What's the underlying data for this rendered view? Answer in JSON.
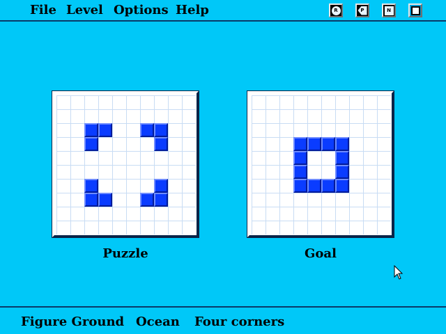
{
  "menu": [
    "File",
    "Level",
    "Options",
    "Help"
  ],
  "toolbar": {
    "reset_glyph": "R",
    "prev_glyph": "P",
    "next_glyph": "N",
    "exit_glyph": ""
  },
  "boards": {
    "puzzle": {
      "label": "Puzzle",
      "grid_size": 10,
      "filled_cells": [
        [
          2,
          2
        ],
        [
          3,
          2
        ],
        [
          2,
          3
        ],
        [
          6,
          2
        ],
        [
          7,
          2
        ],
        [
          7,
          3
        ],
        [
          2,
          6
        ],
        [
          2,
          7
        ],
        [
          3,
          7
        ],
        [
          7,
          6
        ],
        [
          6,
          7
        ],
        [
          7,
          7
        ]
      ]
    },
    "goal": {
      "label": "Goal",
      "grid_size": 10,
      "filled_cells": [
        [
          3,
          3
        ],
        [
          4,
          3
        ],
        [
          5,
          3
        ],
        [
          6,
          3
        ],
        [
          3,
          4
        ],
        [
          6,
          4
        ],
        [
          3,
          5
        ],
        [
          6,
          5
        ],
        [
          3,
          6
        ],
        [
          4,
          6
        ],
        [
          5,
          6
        ],
        [
          6,
          6
        ]
      ]
    }
  },
  "status": {
    "category": "Figure Ground",
    "theme": "Ocean",
    "level": "Four corners"
  },
  "colors": {
    "background": "#00c8f8",
    "tile": "#0a3cff",
    "grid_line": "#c8dcf4"
  }
}
